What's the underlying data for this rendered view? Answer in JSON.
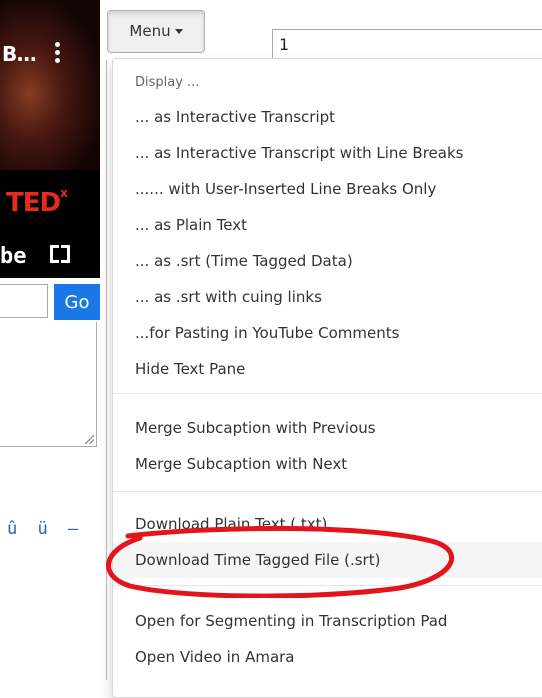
{
  "video": {
    "title_truncated": "B...",
    "brand": "TED",
    "brand_sup": "x",
    "youtube_fragment": "be"
  },
  "search": {
    "go_label": "Go",
    "input_value": ""
  },
  "character_row": [
    "û",
    "ü",
    "–"
  ],
  "menu_button": {
    "label": "Menu"
  },
  "segment_input": {
    "value": "1"
  },
  "dropdown": {
    "header": "Display ...",
    "display_items": [
      "... as Interactive Transcript",
      "... as Interactive Transcript with Line Breaks",
      "...... with User-Inserted Line Breaks Only",
      "... as Plain Text",
      "... as .srt (Time Tagged Data)",
      "... as .srt with cuing links",
      "...for Pasting in YouTube Comments",
      "Hide Text Pane"
    ],
    "merge_items": [
      "Merge Subcaption with Previous",
      "Merge Subcaption with Next"
    ],
    "download_items": [
      "Download Plain Text (.txt)",
      "Download Time Tagged File (.srt)"
    ],
    "open_items": [
      "Open for Segmenting in Transcription Pad",
      "Open Video in Amara"
    ]
  },
  "colors": {
    "accent_go": "#1a78e6",
    "annotation_circle": "#e3141b",
    "ted_red": "#e62b1e"
  }
}
